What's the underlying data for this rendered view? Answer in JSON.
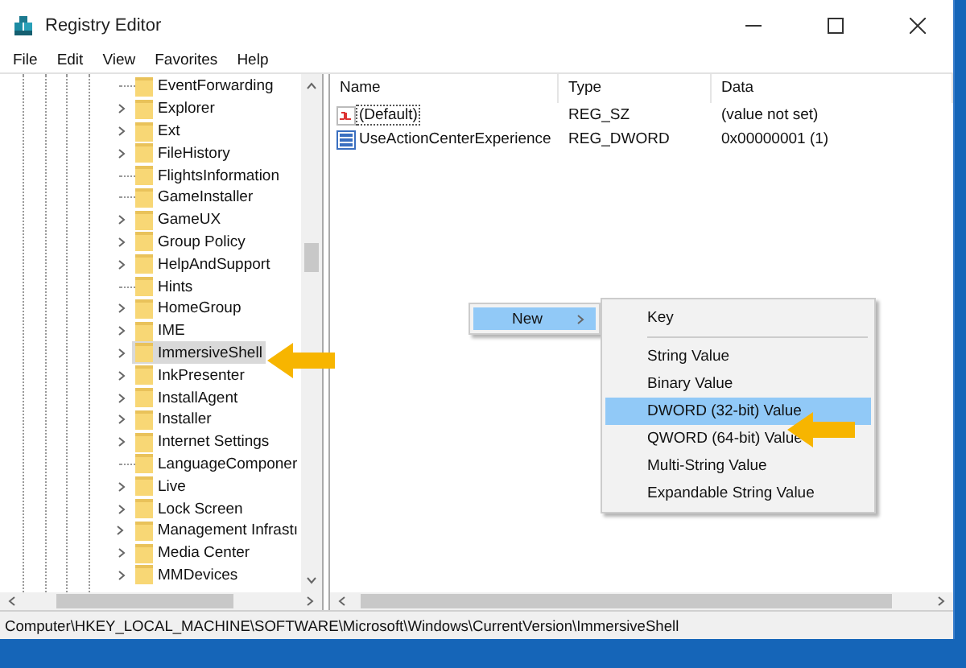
{
  "window": {
    "title": "Registry Editor"
  },
  "menu_bar": [
    "File",
    "Edit",
    "View",
    "Favorites",
    "Help"
  ],
  "tree": {
    "items": [
      {
        "label": "EventForwarding",
        "expandable": false,
        "selected": false
      },
      {
        "label": "Explorer",
        "expandable": true,
        "selected": false
      },
      {
        "label": "Ext",
        "expandable": true,
        "selected": false
      },
      {
        "label": "FileHistory",
        "expandable": true,
        "selected": false
      },
      {
        "label": "FlightsInformation",
        "expandable": false,
        "selected": false
      },
      {
        "label": "GameInstaller",
        "expandable": false,
        "selected": false
      },
      {
        "label": "GameUX",
        "expandable": true,
        "selected": false
      },
      {
        "label": "Group Policy",
        "expandable": true,
        "selected": false
      },
      {
        "label": "HelpAndSupport",
        "expandable": true,
        "selected": false
      },
      {
        "label": "Hints",
        "expandable": false,
        "selected": false
      },
      {
        "label": "HomeGroup",
        "expandable": true,
        "selected": false
      },
      {
        "label": "IME",
        "expandable": true,
        "selected": false
      },
      {
        "label": "ImmersiveShell",
        "expandable": true,
        "selected": true
      },
      {
        "label": "InkPresenter",
        "expandable": true,
        "selected": false
      },
      {
        "label": "InstallAgent",
        "expandable": true,
        "selected": false
      },
      {
        "label": "Installer",
        "expandable": true,
        "selected": false
      },
      {
        "label": "Internet Settings",
        "expandable": true,
        "selected": false
      },
      {
        "label": "LanguageComponer",
        "expandable": false,
        "selected": false
      },
      {
        "label": "Live",
        "expandable": true,
        "selected": false
      },
      {
        "label": "Lock Screen",
        "expandable": true,
        "selected": false
      },
      {
        "label": "Management Infrastı",
        "expandable": true,
        "selected": false
      },
      {
        "label": "Media Center",
        "expandable": true,
        "selected": false
      },
      {
        "label": "MMDevices",
        "expandable": true,
        "selected": false
      }
    ]
  },
  "values": {
    "columns": [
      "Name",
      "Type",
      "Data"
    ],
    "rows": [
      {
        "kind": "string",
        "name": "(Default)",
        "type": "REG_SZ",
        "data": "(value not set)",
        "focused": true
      },
      {
        "kind": "binary",
        "name": "UseActionCenterExperience",
        "type": "REG_DWORD",
        "data": "0x00000001 (1)",
        "focused": false
      }
    ]
  },
  "context_menu": {
    "items": [
      {
        "label": "New",
        "submenu": true,
        "selected": true
      }
    ]
  },
  "submenu": {
    "items": [
      {
        "kind": "item",
        "label": "Key",
        "selected": false
      },
      {
        "kind": "separator"
      },
      {
        "kind": "item",
        "label": "String Value",
        "selected": false
      },
      {
        "kind": "item",
        "label": "Binary Value",
        "selected": false
      },
      {
        "kind": "item",
        "label": "DWORD (32-bit) Value",
        "selected": true
      },
      {
        "kind": "item",
        "label": "QWORD (64-bit) Value",
        "selected": false
      },
      {
        "kind": "item",
        "label": "Multi-String Value",
        "selected": false
      },
      {
        "kind": "item",
        "label": "Expandable String Value",
        "selected": false
      }
    ]
  },
  "status_bar": "Computer\\HKEY_LOCAL_MACHINE\\SOFTWARE\\Microsoft\\Windows\\CurrentVersion\\ImmersiveShell"
}
